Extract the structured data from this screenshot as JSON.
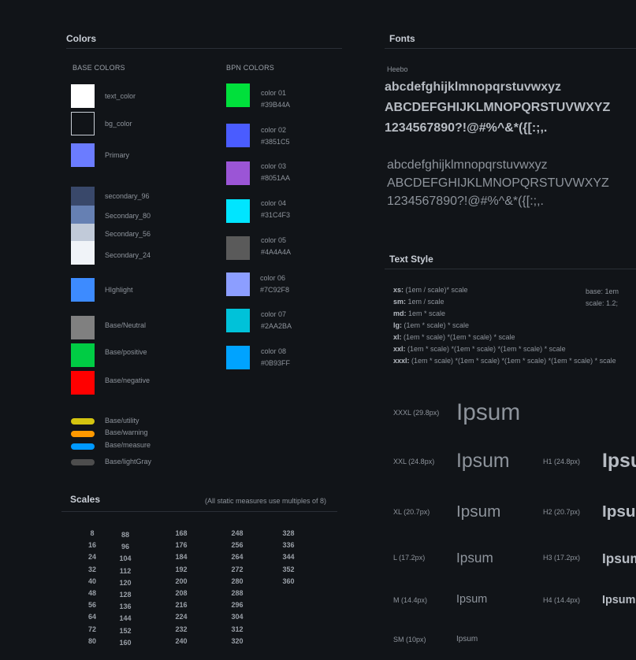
{
  "colors_section": {
    "title": "Colors",
    "base_colors_heading": "BASE COLORS",
    "bpn_colors_heading": "BPN COLORS",
    "base": [
      {
        "label": "text_color",
        "color": "#FFFFFF"
      },
      {
        "label": "bg_color",
        "color": "#111418"
      },
      {
        "label": "Primary",
        "color": "#6B7CFF"
      },
      {
        "label": "secondary_96",
        "color": "#39486A"
      },
      {
        "label": "Secondary_80",
        "color": "#6680B3"
      },
      {
        "label": "Secondary_56",
        "color": "#C1CAD9"
      },
      {
        "label": "Secondary_24",
        "color": "#F0F3F8"
      },
      {
        "label": "HIghlight",
        "color": "#3D8BFF"
      },
      {
        "label": "Base/Neutral",
        "color": "#808080"
      },
      {
        "label": "Base/positive",
        "color": "#00CC44"
      },
      {
        "label": "Base/negative",
        "color": "#FF0000"
      }
    ],
    "utility": [
      {
        "label": "Base/utility",
        "color": "#D4C410"
      },
      {
        "label": "Base/warning",
        "color": "#FF9900"
      },
      {
        "label": "Base/measure",
        "color": "#0099FF"
      },
      {
        "label": "Base/lightGray",
        "color": "#4D4D4D"
      }
    ],
    "bpn": [
      {
        "name": "color 01",
        "hex": "#39B44A",
        "color": "#00E03B"
      },
      {
        "name": "color 02",
        "hex": "#3851C5",
        "color": "#4A5CFF"
      },
      {
        "name": "color 03",
        "hex": "#8051AA",
        "color": "#9B55D6"
      },
      {
        "name": "color 04",
        "hex": "#31C4F3",
        "color": "#00E5FF"
      },
      {
        "name": "color 05",
        "hex": "#4A4A4A",
        "color": "#5A5A5A"
      },
      {
        "name": "color 06",
        "hex": "#7C92F8",
        "color": "#8C9EFF"
      },
      {
        "name": "color 07",
        "hex": "#2AA2BA",
        "color": "#00C2D9"
      },
      {
        "name": "color 08",
        "hex": "#0B93FF",
        "color": "#00A3FF"
      }
    ]
  },
  "scales_section": {
    "title": "Scales",
    "note": "(All static measures use multiples of 8)",
    "columns": [
      [
        "8",
        "16",
        "24",
        "32",
        "40",
        "48",
        "56",
        "64",
        "72",
        "80"
      ],
      [
        "88",
        "96",
        "104",
        "112",
        "120",
        "128",
        "136",
        "144",
        "152",
        "160"
      ],
      [
        "168",
        "176",
        "184",
        "192",
        "200",
        "208",
        "216",
        "224",
        "232",
        "240"
      ],
      [
        "248",
        "256",
        "264",
        "272",
        "280",
        "288",
        "296",
        "304",
        "312",
        "320"
      ],
      [
        "328",
        "336",
        "344",
        "352",
        "360"
      ]
    ]
  },
  "fonts_section": {
    "title": "Fonts",
    "font_name": "Heebo",
    "lowercase": "abcdefghijklmnopqrstuvwxyz",
    "uppercase": "ABCDEFGHIJKLMNOPQRSTUVWXYZ",
    "digits": "1234567890?!@#%^&*({[:;,."
  },
  "text_style_section": {
    "title": "Text Style",
    "formulas": [
      {
        "key": "xs:",
        "value": " (1em / scale)* scale"
      },
      {
        "key": "sm:",
        "value": " 1em / scale"
      },
      {
        "key": "md:",
        "value": " 1em * scale"
      },
      {
        "key": "lg:",
        "value": " (1em * scale) * scale"
      },
      {
        "key": "xl:",
        "value": " (1em * scale) *(1em * scale) * scale"
      },
      {
        "key": "xxl:",
        "value": " (1em * scale) *(1em * scale) *(1em * scale) * scale"
      },
      {
        "key": "xxxl:",
        "value": " (1em * scale) *(1em * scale) *(1em * scale) *(1em * scale) * scale"
      }
    ],
    "base": "base: 1em",
    "scale": "scale: 1.2;",
    "sizes": [
      {
        "label": "XXXL (29.8px)",
        "sample": "Ipsum"
      },
      {
        "label": "XXL (24.8px)",
        "sample": "Ipsum"
      },
      {
        "label": "XL (20.7px)",
        "sample": "Ipsum"
      },
      {
        "label": "L (17.2px)",
        "sample": "Ipsum"
      },
      {
        "label": "M (14.4px)",
        "sample": "Ipsum"
      },
      {
        "label": "SM (10px)",
        "sample": "Ipsum"
      }
    ],
    "headings": [
      {
        "label": "H1 (24.8px)",
        "sample": "Ipsum"
      },
      {
        "label": "H2 (20.7px)",
        "sample": "Ipsum"
      },
      {
        "label": "H3 (17.2px)",
        "sample": "Ipsum"
      },
      {
        "label": "H4 (14.4px)",
        "sample": "Ipsum"
      }
    ]
  }
}
